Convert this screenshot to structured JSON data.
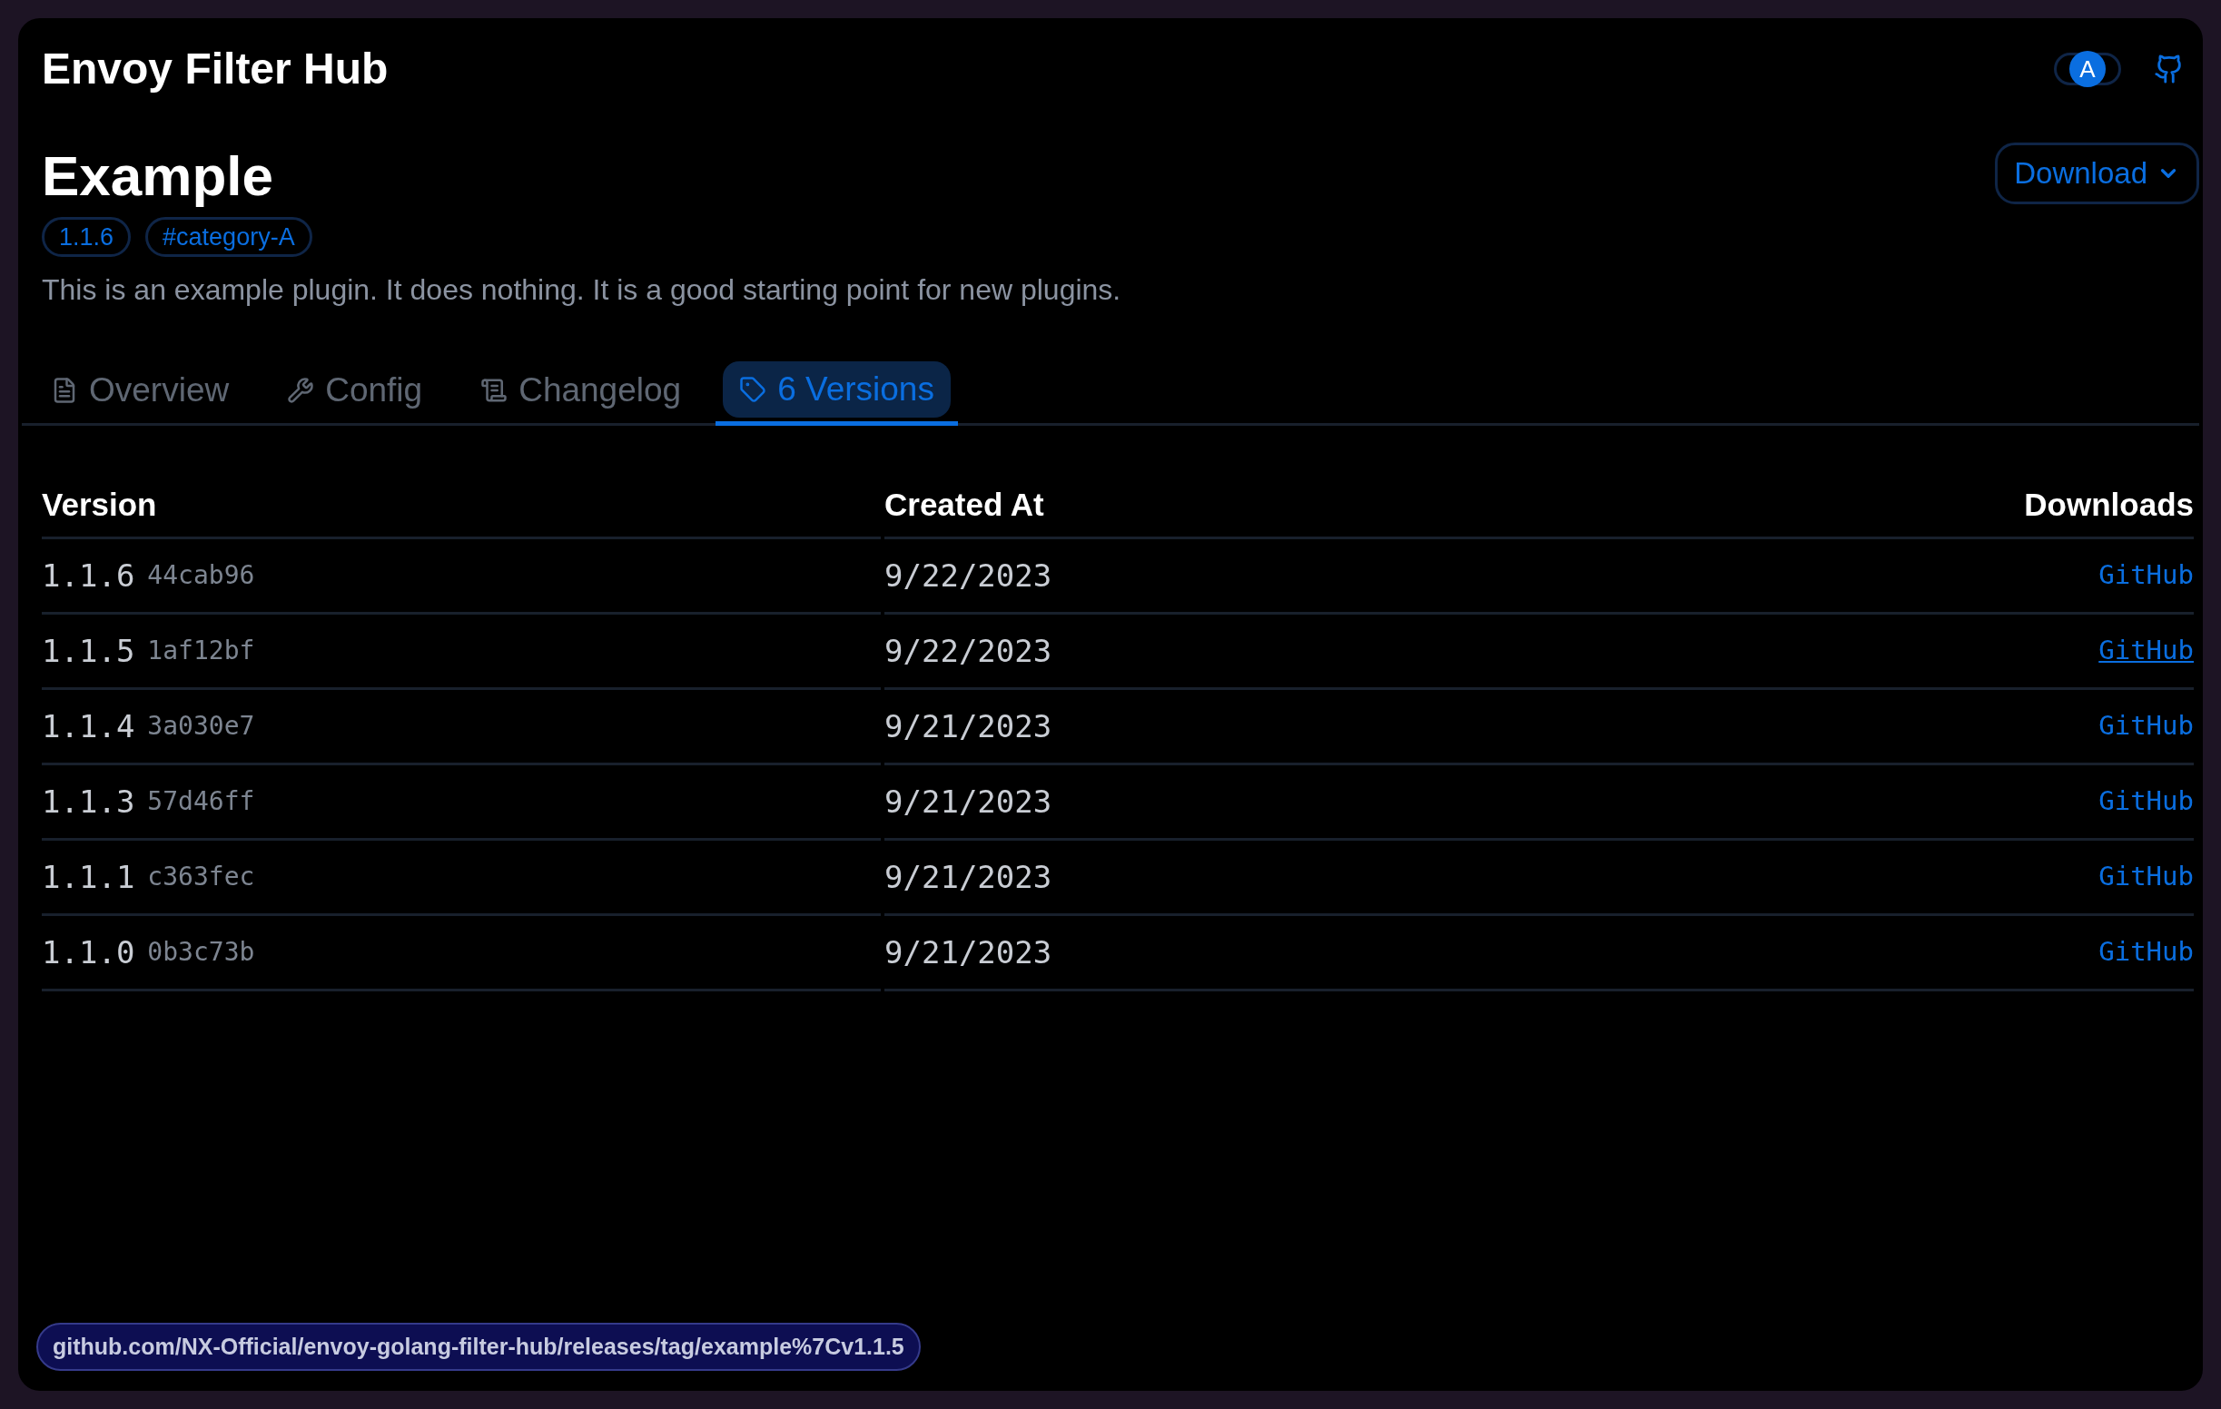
{
  "header": {
    "title": "Envoy Filter Hub",
    "theme_toggle": {
      "label": "A"
    }
  },
  "plugin": {
    "name": "Example",
    "tags": [
      "1.1.6",
      "#category-A"
    ],
    "description": "This is an example plugin. It does nothing. It is a good starting point for new plugins.",
    "download_button": "Download"
  },
  "tabs": [
    {
      "label": "Overview",
      "kind": "file",
      "selected": false
    },
    {
      "label": "Config",
      "kind": "wrench",
      "selected": false
    },
    {
      "label": "Changelog",
      "kind": "scroll",
      "selected": false
    },
    {
      "label": "6 Versions",
      "kind": "tag",
      "selected": true
    }
  ],
  "table": {
    "columns": [
      "Version",
      "Created At",
      "Downloads"
    ],
    "rows": [
      {
        "version": "1.1.6",
        "commit": "44cab96",
        "created_at": "9/22/2023",
        "download": "GitHub",
        "hovered": false
      },
      {
        "version": "1.1.5",
        "commit": "1af12bf",
        "created_at": "9/22/2023",
        "download": "GitHub",
        "hovered": true
      },
      {
        "version": "1.1.4",
        "commit": "3a030e7",
        "created_at": "9/21/2023",
        "download": "GitHub",
        "hovered": false
      },
      {
        "version": "1.1.3",
        "commit": "57d46ff",
        "created_at": "9/21/2023",
        "download": "GitHub",
        "hovered": false
      },
      {
        "version": "1.1.1",
        "commit": "c363fec",
        "created_at": "9/21/2023",
        "download": "GitHub",
        "hovered": false
      },
      {
        "version": "1.1.0",
        "commit": "0b3c73b",
        "created_at": "9/21/2023",
        "download": "GitHub",
        "hovered": false
      }
    ]
  },
  "status_bar": {
    "url": "github.com/NX-Official/envoy-golang-filter-hub/releases/tag/example%7Cv1.1.5"
  }
}
